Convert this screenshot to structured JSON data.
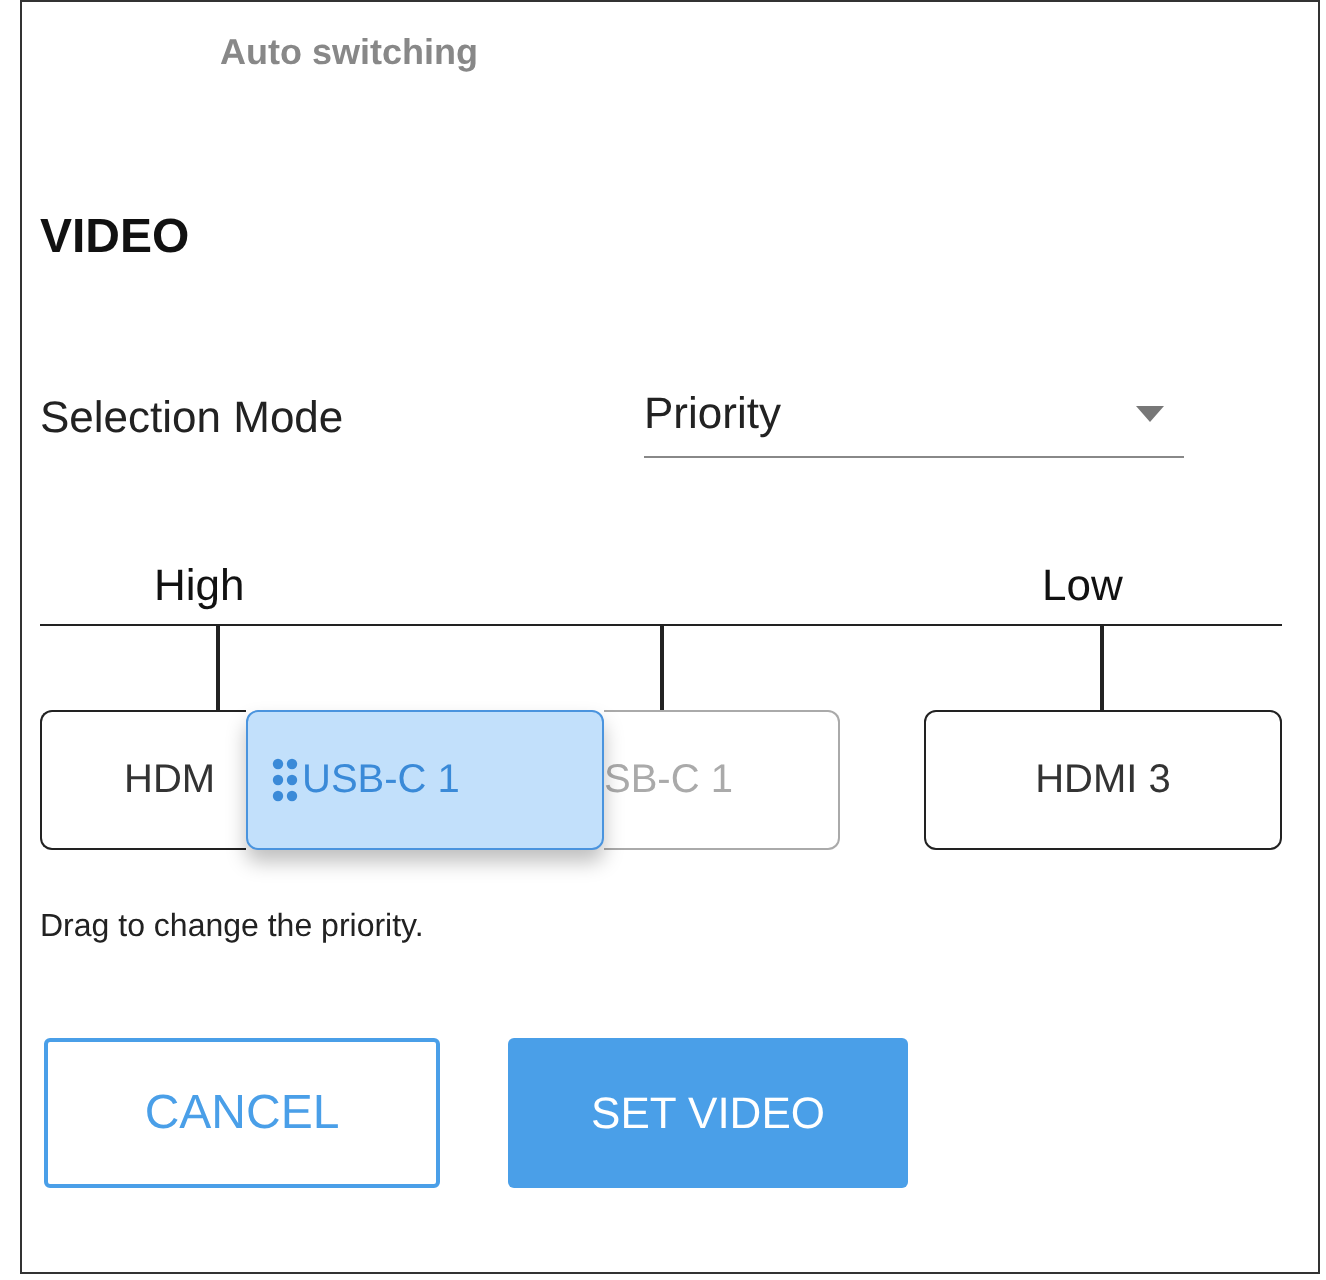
{
  "header": {
    "title": "Auto switching"
  },
  "section": {
    "title": "VIDEO"
  },
  "selection_mode": {
    "label": "Selection Mode",
    "value": "Priority"
  },
  "priority": {
    "high_label": "High",
    "low_label": "Low",
    "slots": [
      {
        "kind": "source",
        "label": "HDM"
      },
      {
        "kind": "placeholder",
        "label": "SB-C 1"
      },
      {
        "kind": "source",
        "label": "HDMI 3"
      }
    ],
    "dragged": {
      "label": "USB-C 1"
    },
    "hint": "Drag to change the priority."
  },
  "buttons": [
    {
      "kind": "outline",
      "label": "CANCEL"
    },
    {
      "kind": "filled",
      "label": "SET VIDEO"
    }
  ]
}
